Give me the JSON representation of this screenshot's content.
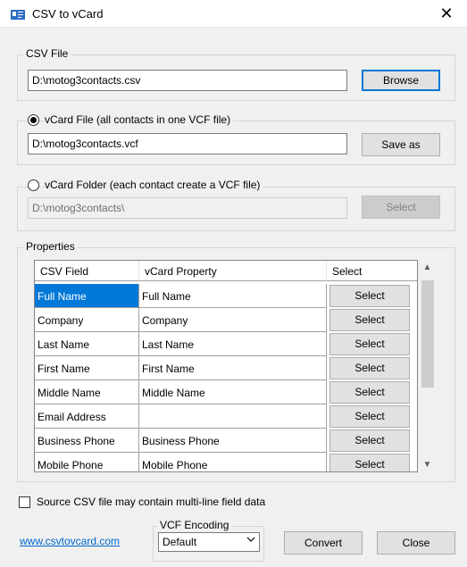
{
  "window": {
    "title": "CSV to vCard",
    "close_glyph": "✕"
  },
  "csv_file": {
    "group_label": "CSV File",
    "path": "D:\\motog3contacts.csv",
    "browse_label": "Browse"
  },
  "vcard_file": {
    "option_label": "vCard File (all contacts in one VCF file)",
    "selected": true,
    "path": "D:\\motog3contacts.vcf",
    "save_label": "Save as"
  },
  "vcard_folder": {
    "option_label": "vCard Folder (each contact create a VCF file)",
    "selected": false,
    "path": "D:\\motog3contacts\\",
    "select_label": "Select"
  },
  "properties": {
    "group_label": "Properties",
    "columns": [
      "CSV Field",
      "vCard Property",
      "Select"
    ],
    "rows": [
      {
        "csv": "Full Name",
        "vcard": "Full Name",
        "btn": "Select"
      },
      {
        "csv": "Company",
        "vcard": "Company",
        "btn": "Select"
      },
      {
        "csv": "Last Name",
        "vcard": "Last Name",
        "btn": "Select"
      },
      {
        "csv": "First Name",
        "vcard": "First Name",
        "btn": "Select"
      },
      {
        "csv": "Middle Name",
        "vcard": "Middle Name",
        "btn": "Select"
      },
      {
        "csv": "Email Address",
        "vcard": "",
        "btn": "Select"
      },
      {
        "csv": "Business Phone",
        "vcard": "Business Phone",
        "btn": "Select"
      },
      {
        "csv": "Mobile Phone",
        "vcard": "Mobile Phone",
        "btn": "Select"
      }
    ]
  },
  "multiline": {
    "label": "Source CSV file may contain multi-line field data",
    "checked": false
  },
  "footer": {
    "link": "www.csvtovcard.com",
    "encoding_label": "VCF Encoding",
    "encoding_value": "Default",
    "convert_label": "Convert",
    "close_label": "Close"
  },
  "colors": {
    "accent": "#0078d7",
    "link": "#0066cc"
  }
}
